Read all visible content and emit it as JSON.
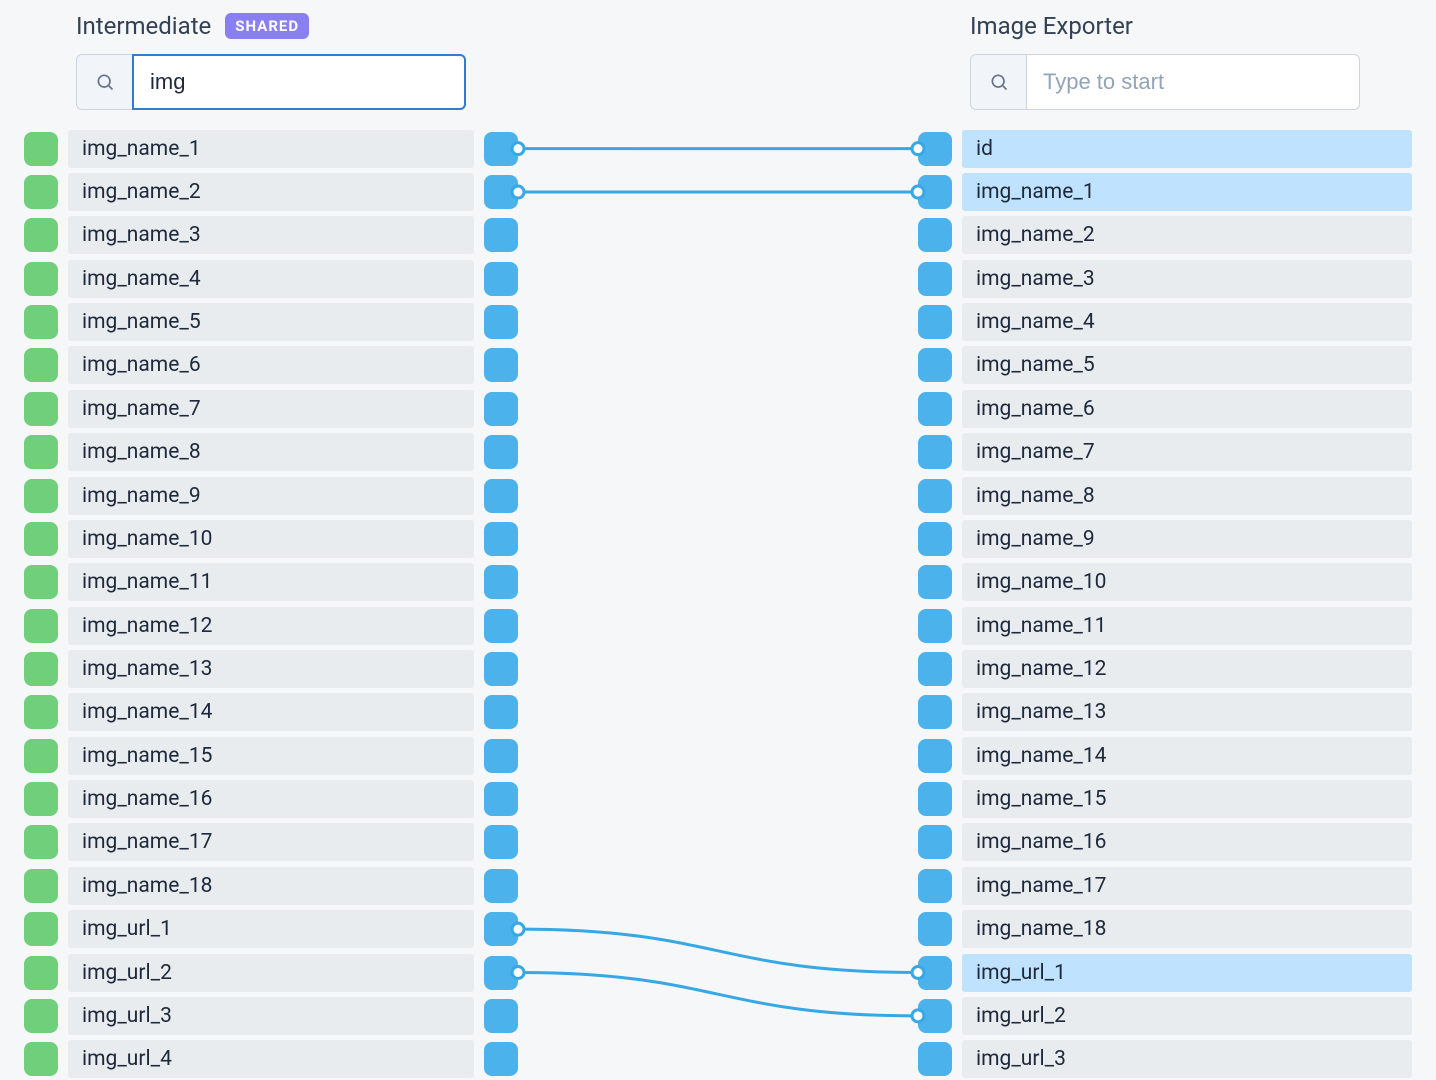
{
  "left": {
    "title": "Intermediate",
    "badge": "SHARED",
    "search": {
      "value": "img",
      "placeholder": ""
    },
    "fields": [
      {
        "label": "img_name_1",
        "linked": true
      },
      {
        "label": "img_name_2",
        "linked": true
      },
      {
        "label": "img_name_3"
      },
      {
        "label": "img_name_4"
      },
      {
        "label": "img_name_5"
      },
      {
        "label": "img_name_6"
      },
      {
        "label": "img_name_7"
      },
      {
        "label": "img_name_8"
      },
      {
        "label": "img_name_9"
      },
      {
        "label": "img_name_10"
      },
      {
        "label": "img_name_11"
      },
      {
        "label": "img_name_12"
      },
      {
        "label": "img_name_13"
      },
      {
        "label": "img_name_14"
      },
      {
        "label": "img_name_15"
      },
      {
        "label": "img_name_16"
      },
      {
        "label": "img_name_17"
      },
      {
        "label": "img_name_18"
      },
      {
        "label": "img_url_1",
        "linked": true
      },
      {
        "label": "img_url_2",
        "linked": true
      },
      {
        "label": "img_url_3"
      },
      {
        "label": "img_url_4"
      }
    ]
  },
  "right": {
    "title": "Image Exporter",
    "search": {
      "value": "",
      "placeholder": "Type to start"
    },
    "fields": [
      {
        "label": "id",
        "highlight": true,
        "linked": true
      },
      {
        "label": "img_name_1",
        "highlight": true,
        "linked": true
      },
      {
        "label": "img_name_2"
      },
      {
        "label": "img_name_3"
      },
      {
        "label": "img_name_4"
      },
      {
        "label": "img_name_5"
      },
      {
        "label": "img_name_6"
      },
      {
        "label": "img_name_7"
      },
      {
        "label": "img_name_8"
      },
      {
        "label": "img_name_9"
      },
      {
        "label": "img_name_10"
      },
      {
        "label": "img_name_11"
      },
      {
        "label": "img_name_12"
      },
      {
        "label": "img_name_13"
      },
      {
        "label": "img_name_14"
      },
      {
        "label": "img_name_15"
      },
      {
        "label": "img_name_16"
      },
      {
        "label": "img_name_17"
      },
      {
        "label": "img_name_18"
      },
      {
        "label": "img_url_1",
        "highlight": true,
        "linked": true
      },
      {
        "label": "img_url_2",
        "linked": true
      },
      {
        "label": "img_url_3"
      }
    ]
  },
  "connections": [
    {
      "from": 0,
      "to": 0
    },
    {
      "from": 1,
      "to": 1
    },
    {
      "from": 18,
      "to": 19
    },
    {
      "from": 19,
      "to": 20
    }
  ],
  "colors": {
    "input_chip": "#6fcf7a",
    "port_chip": "#4bb2ec",
    "link_stroke": "#37a7e6",
    "highlight_row": "#bfe3ff",
    "badge_bg": "#8a7ff0"
  }
}
